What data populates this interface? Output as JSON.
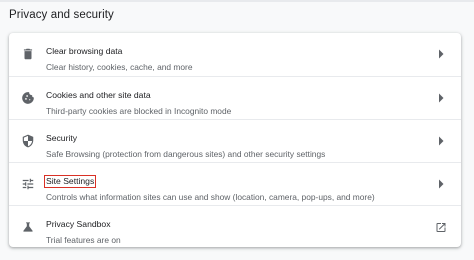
{
  "section": {
    "title": "Privacy and security"
  },
  "rows": [
    {
      "icon": "trash-icon",
      "label": "Clear browsing data",
      "sub": "Clear history, cookies, cache, and more",
      "action_icon": "chevron-right-icon"
    },
    {
      "icon": "cookie-icon",
      "label": "Cookies and other site data",
      "sub": "Third-party cookies are blocked in Incognito mode",
      "action_icon": "chevron-right-icon"
    },
    {
      "icon": "shield-icon",
      "label": "Security",
      "sub": "Safe Browsing (protection from dangerous sites) and other security settings",
      "action_icon": "chevron-right-icon"
    },
    {
      "icon": "tune-sliders-icon",
      "label": "Site Settings",
      "sub": "Controls what information sites can use and show (location, camera, pop-ups, and more)",
      "action_icon": "chevron-right-icon",
      "highlighted": true,
      "highlight_color": "#d93025"
    },
    {
      "icon": "flask-icon",
      "label": "Privacy Sandbox",
      "sub": "Trial features are on",
      "action_icon": "open-in-new-icon"
    }
  ],
  "colors": {
    "background": "#f8f9fa",
    "card": "#ffffff",
    "icon": "#5f6368",
    "primary_text": "#202124",
    "secondary_text": "#5f6368"
  }
}
